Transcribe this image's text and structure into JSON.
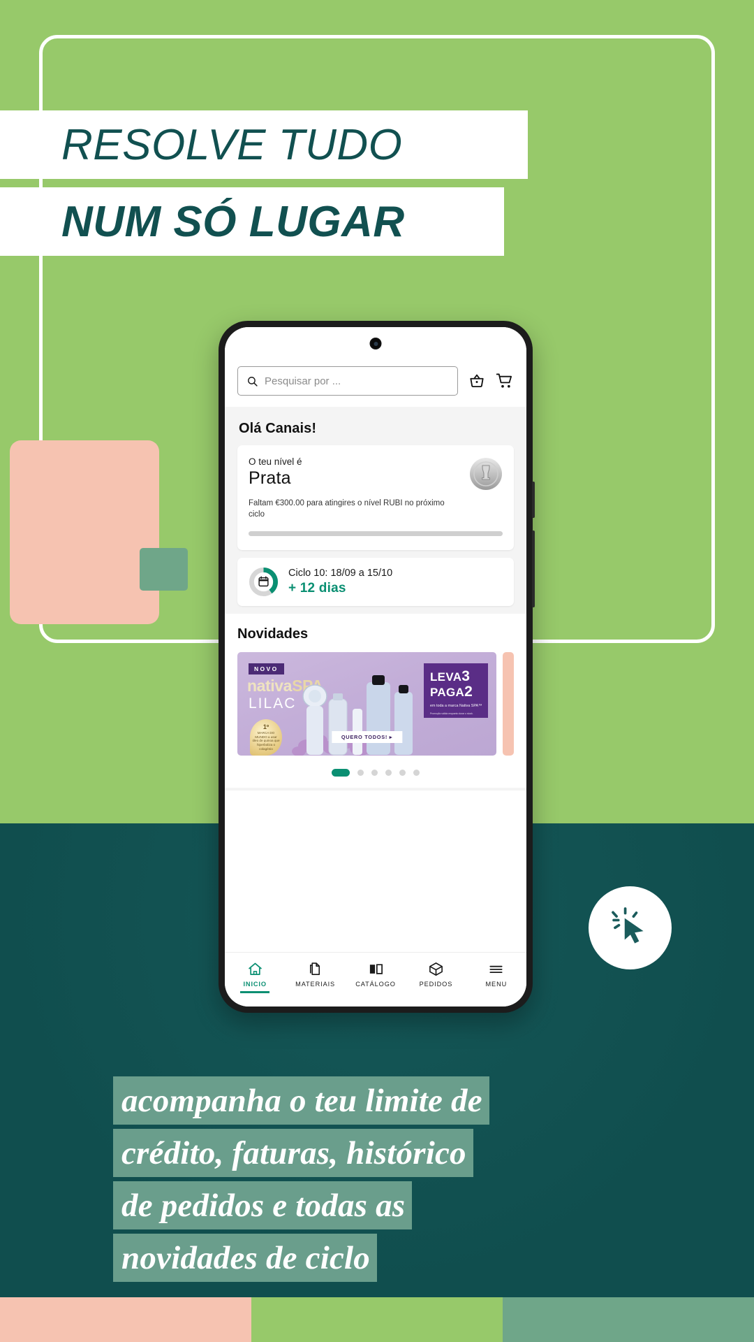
{
  "headline": {
    "line1": "RESOLVE TUDO",
    "line2": "NUM SÓ LUGAR"
  },
  "phone": {
    "search": {
      "placeholder": "Pesquisar por ...",
      "icon": "search-icon"
    },
    "header_icons": [
      {
        "name": "basket-icon"
      },
      {
        "name": "cart-icon"
      }
    ],
    "greeting": "Olá Canais!",
    "level_card": {
      "subtitle": "O teu nível é",
      "level": "Prata",
      "description": "Faltam €300.00 para atingires o nível RUBI no próximo ciclo",
      "progress_percent": 0,
      "badge": "silver-trophy-badge"
    },
    "cycle_card": {
      "title": "Ciclo 10: 18/09 a 15/10",
      "days_left": "+ 12 dias",
      "ring_percent": 40,
      "icon": "calendar-icon"
    },
    "news": {
      "title": "Novidades",
      "banner": {
        "tag": "NOVO",
        "brand_a": "nativa",
        "brand_b": "SPA",
        "brand_line2": "LILAC",
        "seal_top": "1º",
        "seal_text": "MARCA DO MUNDO a usar óleo de quinoa que hiperboliza o colagénio",
        "promo_l1a": "LEVA",
        "promo_n1": "3",
        "promo_l1b": "PAGA",
        "promo_n2": "2",
        "promo_l2": "em toda a marca Nativa SPA™",
        "promo_l3": "Promoção válida enquanto durar o stock.",
        "cta": "QUERO TODOS! ▸"
      },
      "dots_total": 6,
      "dots_active_index": 0
    },
    "bottom_nav": [
      {
        "label": "INICIO",
        "icon": "home-icon",
        "active": true
      },
      {
        "label": "MATERIAIS",
        "icon": "documents-icon",
        "active": false
      },
      {
        "label": "CATÁLOGO",
        "icon": "book-icon",
        "active": false
      },
      {
        "label": "PEDIDOS",
        "icon": "box-icon",
        "active": false
      },
      {
        "label": "MENU",
        "icon": "hamburger-icon",
        "active": false
      }
    ]
  },
  "cursor_badge": {
    "icon": "click-cursor-icon"
  },
  "caption": {
    "lines": [
      "acompanha o teu limite de",
      "crédito, faturas, histórico",
      "de pedidos e todas as",
      "novidades de ciclo"
    ]
  },
  "colors": {
    "green": "#97c96a",
    "teal": "#104e4e",
    "peach": "#f6c3b1",
    "sage": "#6fa689",
    "accent_teal": "#0a8f72",
    "headline_text": "#115050"
  }
}
